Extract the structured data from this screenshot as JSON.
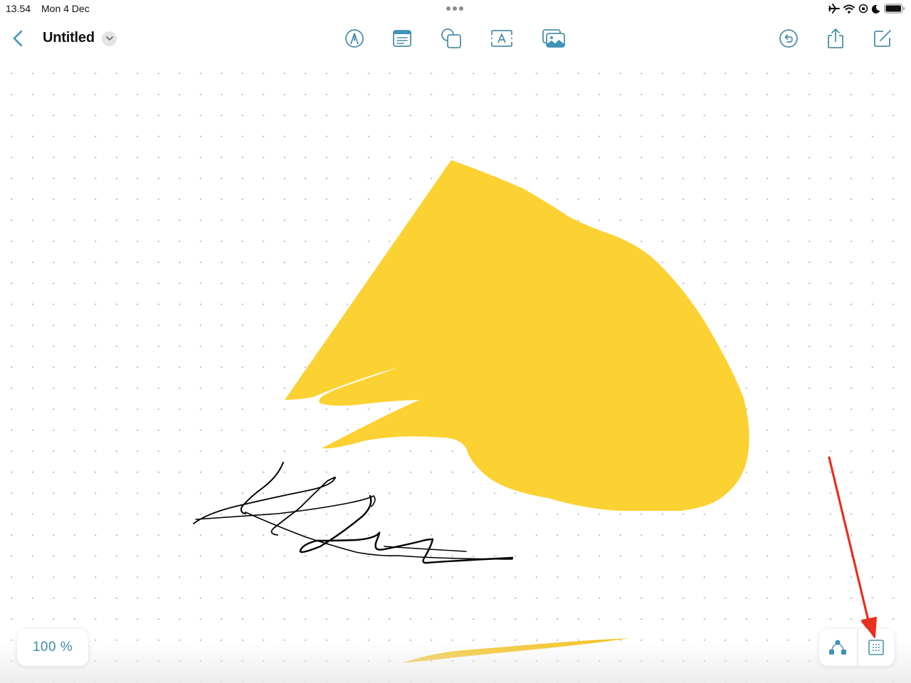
{
  "status_bar": {
    "time": "13.54",
    "date": "Mon 4 Dec",
    "icons": [
      "airplane-mode-icon",
      "wifi-icon",
      "orientation-lock-icon",
      "do-not-disturb-moon-icon",
      "battery-icon"
    ],
    "battery_level": 0.95
  },
  "nav": {
    "back_icon": "chevron-left-icon",
    "title": "Untitled",
    "title_menu_icon": "chevron-down-icon",
    "tools": [
      {
        "name": "pen-tool",
        "icon": "pen-nib-circle-icon"
      },
      {
        "name": "sticky-note",
        "icon": "note-card-icon"
      },
      {
        "name": "shapes",
        "icon": "shapes-icon"
      },
      {
        "name": "text-box",
        "icon": "text-box-icon"
      },
      {
        "name": "media",
        "icon": "photos-icon"
      }
    ],
    "actions": [
      {
        "name": "undo",
        "icon": "undo-circle-icon"
      },
      {
        "name": "share",
        "icon": "share-icon"
      },
      {
        "name": "new-board",
        "icon": "compose-icon"
      }
    ]
  },
  "canvas": {
    "background": "dot-grid",
    "items": [
      {
        "type": "freeform-shape",
        "color": "#FCD132"
      },
      {
        "type": "ink-scribble",
        "color": "#000000"
      },
      {
        "type": "ink-stroke",
        "color": "#F3C52A"
      },
      {
        "type": "annotation-arrow",
        "color": "#E8301E"
      }
    ]
  },
  "zoom": {
    "label": "100 %"
  },
  "bottom_controls": [
    {
      "name": "diagram-view",
      "icon": "hierarchy-icon"
    },
    {
      "name": "grid-toggle",
      "icon": "grid-dots-icon"
    }
  ],
  "colors": {
    "accent": "#3E93B8",
    "shape_yellow": "#FCD132",
    "arrow_red": "#E8301E",
    "text": "#111111"
  }
}
